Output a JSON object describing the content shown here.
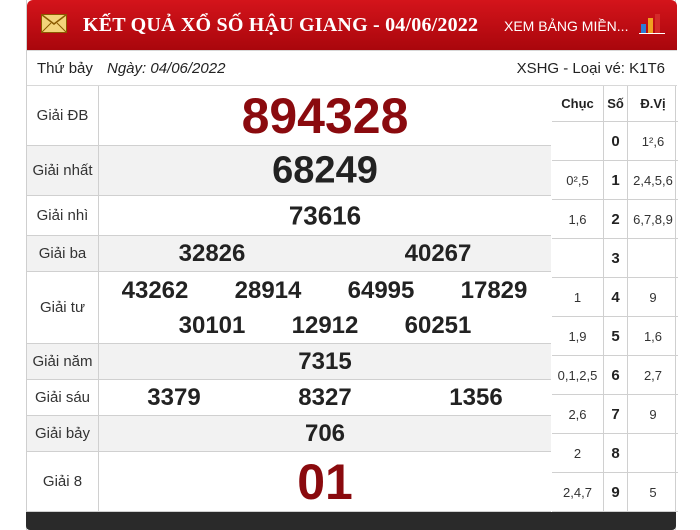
{
  "header": {
    "title": "KẾT QUẢ XỔ SỐ HẬU GIANG - 04/06/2022",
    "link_label": "XEM BẢNG MIỀN...",
    "icons": [
      "mail-icon",
      "bar-chart-icon"
    ],
    "colors": {
      "header_bg": "#c70f16",
      "prize_red": "#8a0a0e"
    }
  },
  "info": {
    "day": "Thứ bảy",
    "date": "Ngày: 04/06/2022",
    "code": "XSHG - Loại vé: K1T6"
  },
  "prizes": [
    {
      "label": "Giải ĐB",
      "numbers": [
        "894328"
      ]
    },
    {
      "label": "Giải nhất",
      "numbers": [
        "68249"
      ]
    },
    {
      "label": "Giải nhì",
      "numbers": [
        "73616"
      ]
    },
    {
      "label": "Giải ba",
      "numbers": [
        "32826",
        "40267"
      ]
    },
    {
      "label": "Giải tư",
      "numbers": [
        "43262",
        "28914",
        "64995",
        "17829",
        "30101",
        "12912",
        "60251"
      ]
    },
    {
      "label": "Giải năm",
      "numbers": [
        "7315"
      ]
    },
    {
      "label": "Giải sáu",
      "numbers": [
        "3379",
        "8327",
        "1356"
      ]
    },
    {
      "label": "Giải bảy",
      "numbers": [
        "706"
      ]
    },
    {
      "label": "Giải 8",
      "numbers": [
        "01"
      ]
    }
  ],
  "loto": {
    "headers": [
      "Chục",
      "Số",
      "Đ.Vị"
    ],
    "rows": [
      {
        "chuc": "",
        "so": "0",
        "dvi": "1²,6"
      },
      {
        "chuc": "0²,5",
        "so": "1",
        "dvi": "2,4,5,6"
      },
      {
        "chuc": "1,6",
        "so": "2",
        "dvi": "6,7,8,9"
      },
      {
        "chuc": "",
        "so": "3",
        "dvi": ""
      },
      {
        "chuc": "1",
        "so": "4",
        "dvi": "9"
      },
      {
        "chuc": "1,9",
        "so": "5",
        "dvi": "1,6"
      },
      {
        "chuc": "0,1,2,5",
        "so": "6",
        "dvi": "2,7"
      },
      {
        "chuc": "2,6",
        "so": "7",
        "dvi": "9"
      },
      {
        "chuc": "2",
        "so": "8",
        "dvi": ""
      },
      {
        "chuc": "2,4,7",
        "so": "9",
        "dvi": "5"
      }
    ]
  }
}
